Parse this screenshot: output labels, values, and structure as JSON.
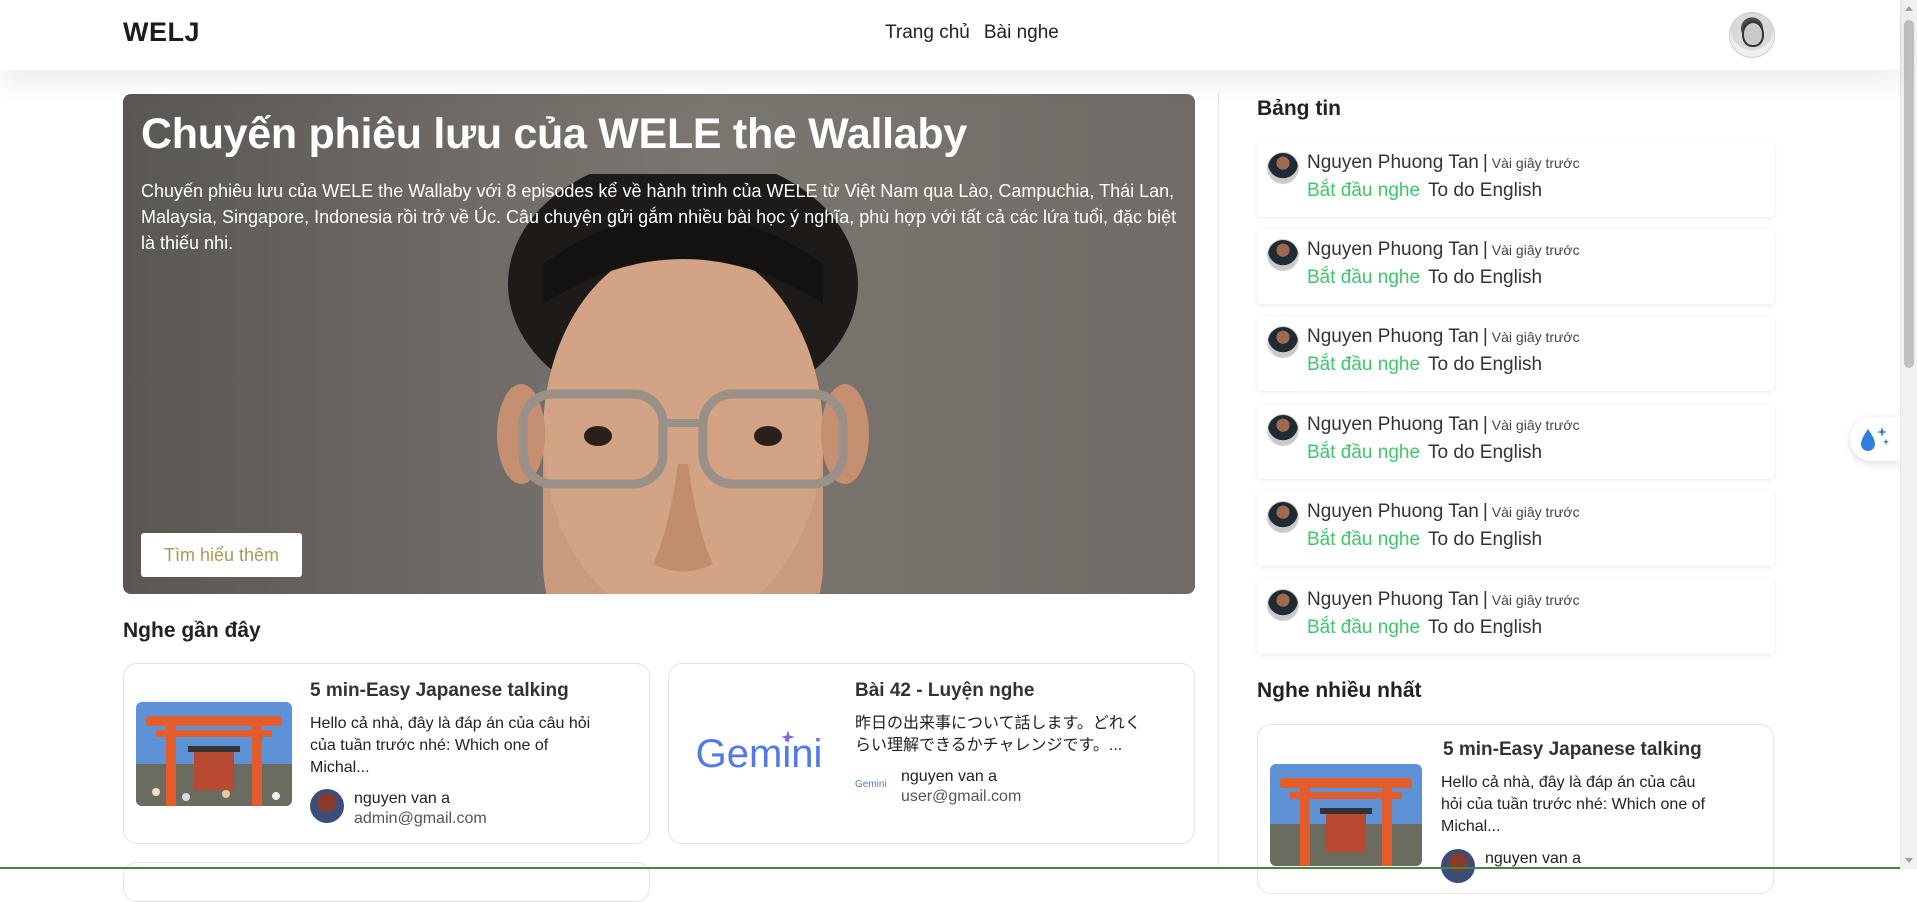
{
  "header": {
    "brand": "WELJ",
    "nav": [
      {
        "label": "Trang chủ"
      },
      {
        "label": "Bài nghe"
      }
    ]
  },
  "hero": {
    "title": "Chuyến phiêu lưu của WELE the Wallaby",
    "description": "Chuyến phiêu lưu của WELE the Wallaby với 8 episodes kể về hành trình của WELE từ Việt Nam qua Lào, Campuchia, Thái Lan, Malaysia, Singapore, Indonesia rồi trở về Úc. Câu chuyện gửi gắm nhiều bài học ý nghĩa, phù hợp với tất cả các lứa tuổi, đặc biệt là thiếu nhi.",
    "cta_label": "Tìm hiểu thêm"
  },
  "recent": {
    "title": "Nghe gần đây",
    "cards": [
      {
        "title": "5 min-Easy Japanese talking",
        "desc": "Hello cả nhà, đây là đáp án của câu hỏi của tuần trước nhé: Which one of Michal...",
        "author_name": "nguyen van a",
        "author_email": "admin@gmail.com",
        "thumb": "torii-gate"
      },
      {
        "title": "Bài 42 - Luyện nghe",
        "desc": "昨日の出来事について話します。どれくらい理解できるかチャレンジです。...",
        "author_name": "nguyen van a",
        "author_email": "user@gmail.com",
        "thumb_text": "Gemini",
        "author_avatar_text": "Gemini"
      }
    ]
  },
  "feed": {
    "title": "Bảng tin",
    "separator": "|",
    "items": [
      {
        "user": "Nguyen Phuong Tan",
        "time": "Vài giây trước",
        "action": "Bắt đầu nghe",
        "target": "To do English"
      },
      {
        "user": "Nguyen Phuong Tan",
        "time": "Vài giây trước",
        "action": "Bắt đầu nghe",
        "target": "To do English"
      },
      {
        "user": "Nguyen Phuong Tan",
        "time": "Vài giây trước",
        "action": "Bắt đầu nghe",
        "target": "To do English"
      },
      {
        "user": "Nguyen Phuong Tan",
        "time": "Vài giây trước",
        "action": "Bắt đầu nghe",
        "target": "To do English"
      },
      {
        "user": "Nguyen Phuong Tan",
        "time": "Vài giây trước",
        "action": "Bắt đầu nghe",
        "target": "To do English"
      },
      {
        "user": "Nguyen Phuong Tan",
        "time": "Vài giây trước",
        "action": "Bắt đầu nghe",
        "target": "To do English"
      }
    ]
  },
  "popular": {
    "title": "Nghe nhiều nhất",
    "card": {
      "title": "5 min-Easy Japanese talking",
      "desc": "Hello cả nhà, đây là đáp án của câu hỏi của tuần trước nhé: Which one of Michal...",
      "author_name": "nguyen van a"
    }
  },
  "colors": {
    "accent_green": "#3ec76a",
    "cta_text": "#a89a5a",
    "gemini_blue": "#4f7ae8"
  },
  "icons": {
    "float_button": "water-drop-sparkle-icon"
  }
}
